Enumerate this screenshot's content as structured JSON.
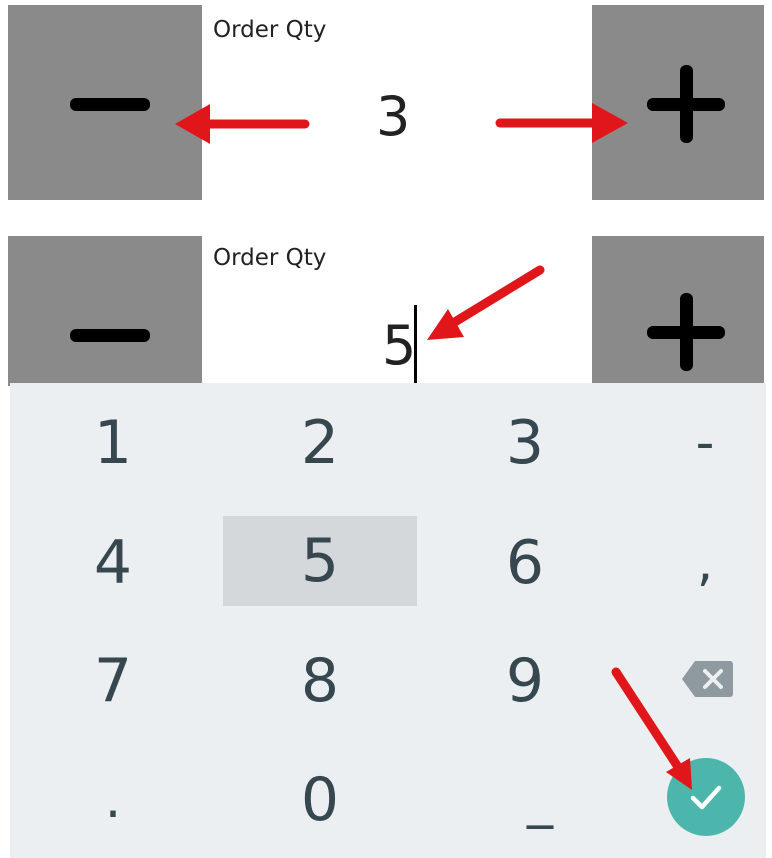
{
  "colors": {
    "stepper_button_bg": "#8a8a8a",
    "keyboard_bg": "#eceff1",
    "key_text": "#37474f",
    "key_pressed_bg": "#d5d8da",
    "done_button_bg": "#4db6ac",
    "annotation_arrow": "#e0161b"
  },
  "panel_top": {
    "label": "Order Qty",
    "value": "3",
    "minus_icon": "minus-icon",
    "plus_icon": "plus-icon"
  },
  "panel_bottom": {
    "label": "Order Qty",
    "value": "5",
    "minus_icon": "minus-icon",
    "plus_icon": "plus-icon"
  },
  "keyboard": {
    "keys": {
      "k1": "1",
      "k2": "2",
      "k3": "3",
      "k_dash": "-",
      "k4": "4",
      "k5": "5",
      "k6": "6",
      "k_comma": ",",
      "k7": "7",
      "k8": "8",
      "k9": "9",
      "k_dot": ".",
      "k0": "0",
      "k_space": "_"
    },
    "pressed_key": "5",
    "backspace_icon": "backspace-icon",
    "done_icon": "check-icon"
  }
}
